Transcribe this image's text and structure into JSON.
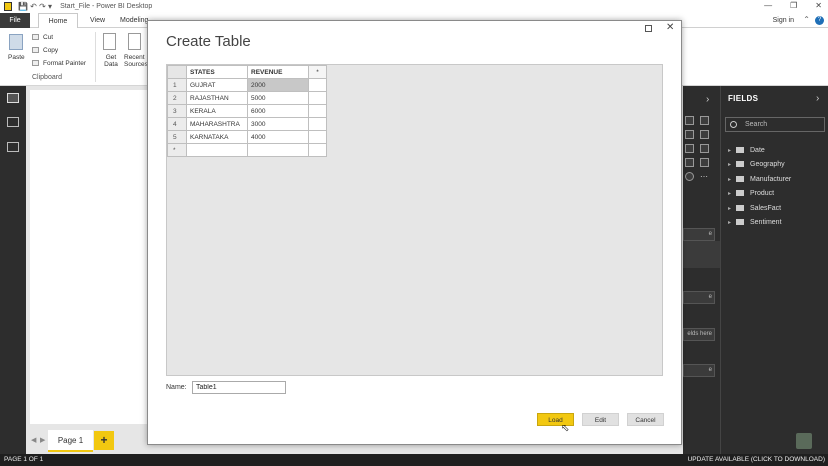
{
  "window": {
    "title": "Start_File - Power BI Desktop",
    "sign_in": "Sign in",
    "help": "?"
  },
  "ribbon": {
    "tabs": [
      "File",
      "Home",
      "View",
      "Modeling"
    ],
    "paste": "Paste",
    "cut": "Cut",
    "copy": "Copy",
    "format_painter": "Format Painter",
    "clipboard_group": "Clipboard",
    "get_data": "Get Data",
    "recent_sources": "Recent Sources"
  },
  "pages": {
    "tab_label": "Page 1",
    "add_label": "+"
  },
  "status": {
    "page": "PAGE 1 OF 1",
    "update": "UPDATE AVAILABLE (CLICK TO DOWNLOAD)"
  },
  "viz_panel": {
    "field_hint": "elds here"
  },
  "fields_panel": {
    "title": "FIELDS",
    "search_placeholder": "Search",
    "tables": [
      "Date",
      "Geography",
      "Manufacturer",
      "Product",
      "SalesFact",
      "Sentiment"
    ]
  },
  "dialog": {
    "title": "Create Table",
    "columns": [
      "STATES",
      "REVENUE"
    ],
    "add_column": "*",
    "rows": [
      {
        "n": "1",
        "state": "GUJRAT",
        "revenue": "2000"
      },
      {
        "n": "2",
        "state": "RAJASTHAN",
        "revenue": "5000"
      },
      {
        "n": "3",
        "state": "KERALA",
        "revenue": "6000"
      },
      {
        "n": "4",
        "state": "MAHARASHTRA",
        "revenue": "3000"
      },
      {
        "n": "5",
        "state": "KARNATAKA",
        "revenue": "4000"
      }
    ],
    "new_row": "*",
    "name_label": "Name:",
    "name_value": "Table1",
    "load": "Load",
    "edit": "Edit",
    "cancel": "Cancel"
  },
  "colors": {
    "accent": "#f2c811",
    "dark_panel": "#2d2d2d"
  }
}
